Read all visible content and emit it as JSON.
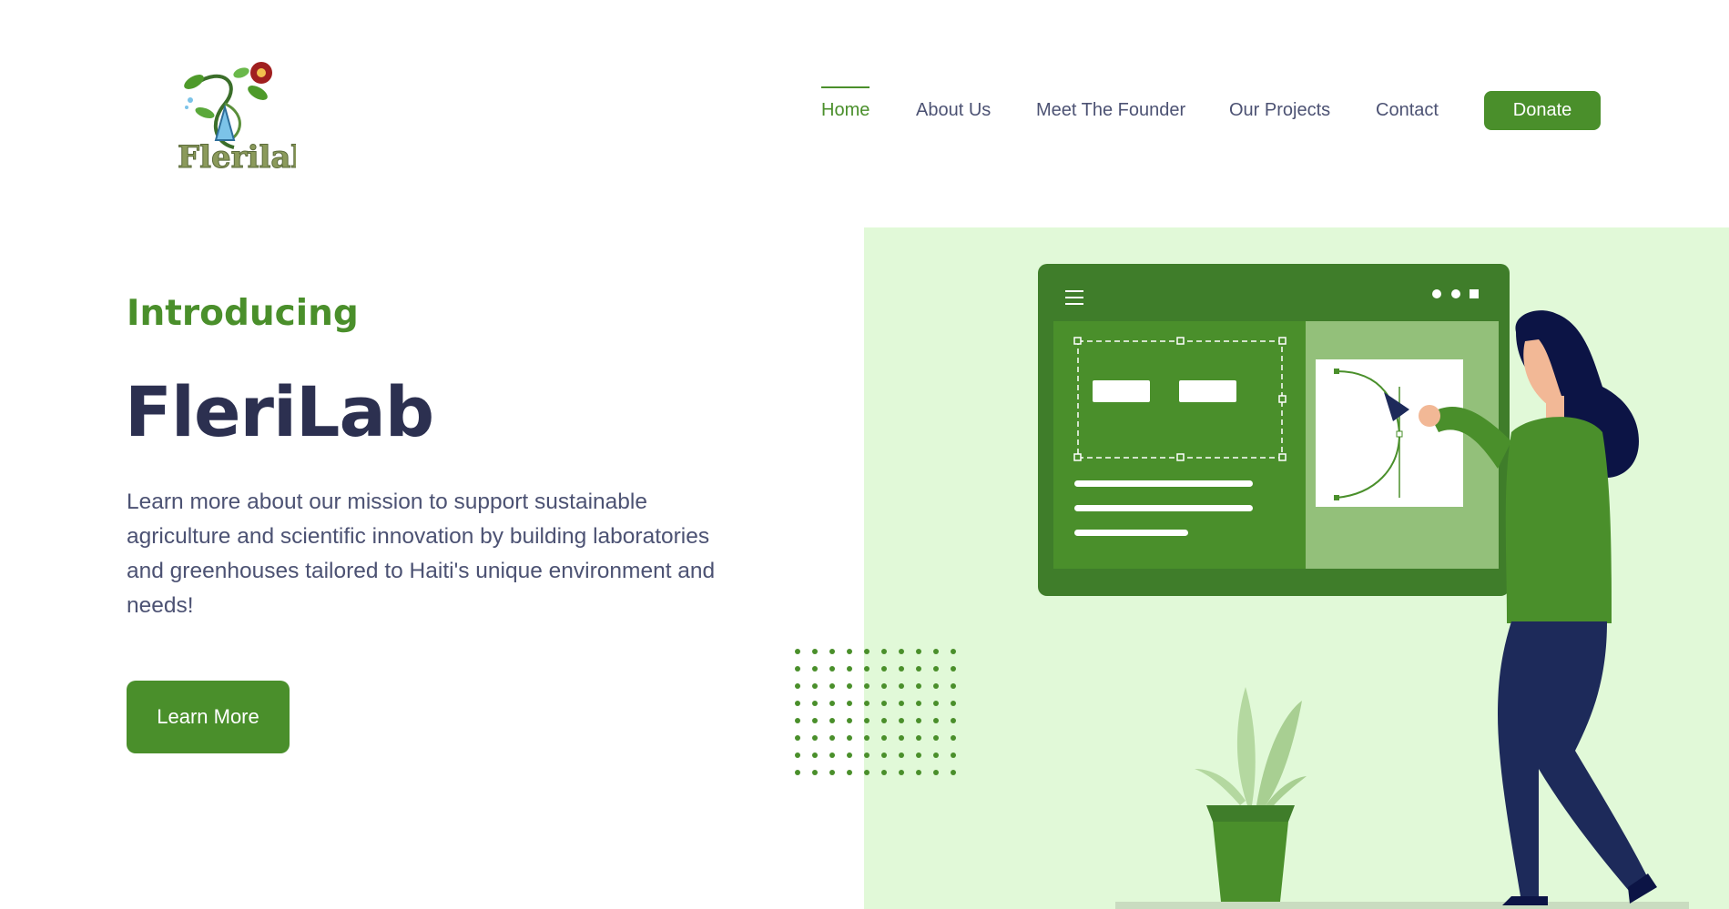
{
  "brand": {
    "logo_text": "Flerilab"
  },
  "nav": {
    "items": [
      {
        "label": "Home",
        "active": true
      },
      {
        "label": "About Us",
        "active": false
      },
      {
        "label": "Meet The Founder",
        "active": false
      },
      {
        "label": "Our Projects",
        "active": false
      },
      {
        "label": "Contact",
        "active": false
      }
    ],
    "donate_label": "Donate"
  },
  "hero": {
    "tagline": "Introducing",
    "title": "FleriLab",
    "description": "Learn more about our mission to support sustainable agriculture and scientific innovation by building laboratories and greenhouses tailored to Haiti's unique environment and needs!",
    "cta_label": "Learn More"
  },
  "colors": {
    "brand_green": "#4a8f2b",
    "text_dark": "#2c3050",
    "text_body": "#4c5273",
    "illustration_bg": "#e1f9d8"
  },
  "icons": [
    "logo-flower-icon",
    "hamburger-menu-icon",
    "window-dots-icon"
  ]
}
